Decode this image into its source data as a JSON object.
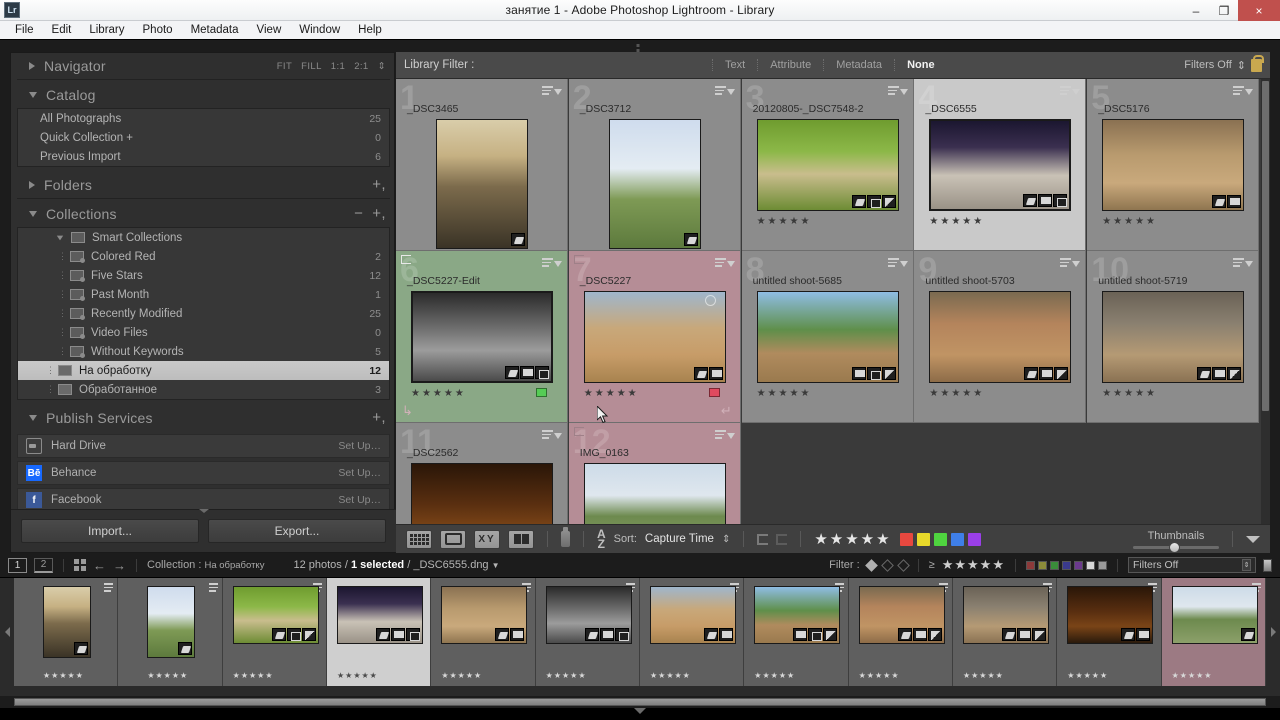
{
  "window": {
    "title": "занятие 1 - Adobe Photoshop Lightroom - Library",
    "app_badge": "Lr",
    "minimize": "–",
    "restore": "❐",
    "close": "×"
  },
  "menubar": {
    "items": [
      "File",
      "Edit",
      "Library",
      "Photo",
      "Metadata",
      "View",
      "Window",
      "Help"
    ]
  },
  "left_panel": {
    "navigator": {
      "title": "Navigator",
      "zoom_levels": [
        "FIT",
        "FILL",
        "1:1",
        "2:1"
      ]
    },
    "catalog": {
      "title": "Catalog",
      "items": [
        {
          "label": "All Photographs",
          "count": "25"
        },
        {
          "label": "Quick Collection  +",
          "count": "0"
        },
        {
          "label": "Previous Import",
          "count": "6"
        }
      ]
    },
    "folders": {
      "title": "Folders"
    },
    "collections": {
      "title": "Collections",
      "smart_label": "Smart Collections",
      "smart_items": [
        {
          "label": "Colored Red",
          "count": "2"
        },
        {
          "label": "Five Stars",
          "count": "12"
        },
        {
          "label": "Past Month",
          "count": "1"
        },
        {
          "label": "Recently Modified",
          "count": "25"
        },
        {
          "label": "Video Files",
          "count": "0"
        },
        {
          "label": "Without Keywords",
          "count": "5"
        }
      ],
      "items": [
        {
          "label": "На обработку",
          "count": "12",
          "selected": true
        },
        {
          "label": "Обработанное",
          "count": "3",
          "selected": false
        }
      ]
    },
    "publish_services": {
      "title": "Publish Services",
      "services": [
        {
          "label": "Hard Drive",
          "action": "Set Up…",
          "icon": "hard-drive-icon"
        },
        {
          "label": "Behance",
          "action": "Set Up…",
          "icon": "behance-icon",
          "mark": "Bē"
        },
        {
          "label": "Facebook",
          "action": "Set Up…",
          "icon": "facebook-icon",
          "mark": "f"
        }
      ]
    },
    "buttons": {
      "import": "Import...",
      "export": "Export..."
    }
  },
  "library_filter": {
    "label": "Library Filter :",
    "tabs": [
      "Text",
      "Attribute",
      "Metadata",
      "None"
    ],
    "active_tab": "None",
    "filters_state": "Filters Off",
    "lock_icon": "lock-icon"
  },
  "grid": {
    "cells": [
      {
        "index": "1",
        "title": "_DSC3465",
        "stars": "★★★★★",
        "badges": [
          "tag"
        ],
        "bg": "normal",
        "orient": "portrait"
      },
      {
        "index": "2",
        "title": "_DSC3712",
        "stars": "★★★★★",
        "badges": [
          "tag"
        ],
        "bg": "normal",
        "orient": "portrait"
      },
      {
        "index": "3",
        "title": "20120805-_DSC7548-2",
        "stars": "★★★★★",
        "badges": [
          "tag",
          "crop",
          "adj"
        ],
        "bg": "normal",
        "orient": "landscape"
      },
      {
        "index": "4",
        "title": "_DSC6555",
        "stars": "★★★★★",
        "badges": [
          "tag",
          "cnt",
          "crop"
        ],
        "bg": "selected",
        "orient": "landscape"
      },
      {
        "index": "5",
        "title": "_DSC5176",
        "stars": "★★★★★",
        "badges": [
          "tag",
          "cnt"
        ],
        "bg": "normal",
        "orient": "landscape"
      },
      {
        "index": "6",
        "title": "_DSC5227-Edit",
        "stars": "★★★★★",
        "badges": [
          "tag",
          "cnt",
          "crop"
        ],
        "bg": "green",
        "label_color": "#55cc55",
        "orient": "landscape"
      },
      {
        "index": "7",
        "title": "_DSC5227",
        "stars": "★★★★★",
        "badges": [
          "tag",
          "cnt"
        ],
        "bg": "pink",
        "label_color": "#e04a5f",
        "orient": "landscape"
      },
      {
        "index": "8",
        "title": "untitled shoot-5685",
        "stars": "★★★★★",
        "badges": [
          "cnt",
          "crop",
          "adj"
        ],
        "bg": "normal",
        "orient": "landscape"
      },
      {
        "index": "9",
        "title": "untitled shoot-5703",
        "stars": "★★★★★",
        "badges": [
          "tag",
          "cnt",
          "adj"
        ],
        "bg": "normal",
        "orient": "landscape"
      },
      {
        "index": "10",
        "title": "untitled shoot-5719",
        "stars": "★★★★★",
        "badges": [
          "tag",
          "cnt",
          "adj"
        ],
        "bg": "normal",
        "orient": "landscape"
      },
      {
        "index": "11",
        "title": "_DSC2562",
        "stars": "★★★★★",
        "badges": [
          "tag",
          "cnt"
        ],
        "bg": "normal",
        "orient": "landscape"
      },
      {
        "index": "12",
        "title": "IMG_0163",
        "stars": "★★★★★",
        "badges": [
          "tag"
        ],
        "bg": "pink",
        "orient": "landscape"
      }
    ]
  },
  "toolbar": {
    "view_modes": [
      "grid-view-icon",
      "loupe-view-icon",
      "compare-view-icon",
      "survey-view-icon"
    ],
    "painter": "spray-can-icon",
    "sort_glyph": "A\nZ",
    "sort_label": "Sort:",
    "sort_value": "Capture Time",
    "flags": [
      "flag-pick-icon",
      "flag-reject-icon"
    ],
    "stars": "★★★★★",
    "color_swatches": [
      "#e8483f",
      "#e8d92a",
      "#4fd43f",
      "#3f7fe8",
      "#9a3fe8"
    ],
    "thumbnails_label": "Thumbnails",
    "expand": "chevron-down-icon"
  },
  "filmstrip": {
    "page_numbers": [
      "1",
      "2"
    ],
    "grid_icon": "grid-icon",
    "back_icon": "back-arrow-icon",
    "forward_icon": "forward-arrow-icon",
    "source_label": "Collection :",
    "source_value": "На обработку",
    "count_text_prefix": "12 photos /",
    "count_selected": "1 selected",
    "count_file": "/ _DSC6555.dng",
    "filter_label": "Filter :",
    "filter_stars": "★★★★★",
    "filter_gte": "≥",
    "filter_swatches": [
      "#8c3a3a",
      "#8c8c3a",
      "#3a8c3a",
      "#3a3a8c",
      "#6b3a8c",
      "#d8d8d8",
      "#9a9a9a"
    ],
    "filters_off": "Filters Off",
    "thumbs": [
      {
        "title": "_DSC3465",
        "stars": "★★★★★",
        "bg": "normal",
        "orient": "portrait",
        "badges": [
          "tag"
        ]
      },
      {
        "title": "_DSC3712",
        "stars": "★★★★★",
        "bg": "normal",
        "orient": "portrait",
        "badges": [
          "tag"
        ]
      },
      {
        "title": "20120805-_DSC7548-2",
        "stars": "★★★★★",
        "bg": "normal",
        "orient": "landscape",
        "badges": [
          "tag",
          "crop",
          "adj"
        ]
      },
      {
        "title": "_DSC6555",
        "stars": "★★★★★",
        "bg": "selected",
        "orient": "landscape",
        "badges": [
          "tag",
          "cnt",
          "crop"
        ]
      },
      {
        "title": "_DSC5176",
        "stars": "★★★★★",
        "bg": "normal",
        "orient": "landscape",
        "badges": [
          "tag",
          "cnt"
        ]
      },
      {
        "title": "_DSC5227-Edit",
        "stars": "★★★★★",
        "bg": "normal",
        "orient": "landscape",
        "badges": [
          "tag",
          "cnt",
          "crop"
        ]
      },
      {
        "title": "_DSC5227",
        "stars": "★★★★★",
        "bg": "normal",
        "orient": "landscape",
        "badges": [
          "tag",
          "cnt"
        ]
      },
      {
        "title": "untitled shoot-5685",
        "stars": "★★★★★",
        "bg": "normal",
        "orient": "landscape",
        "badges": [
          "cnt",
          "crop",
          "adj"
        ]
      },
      {
        "title": "untitled shoot-5703",
        "stars": "★★★★★",
        "bg": "normal",
        "orient": "landscape",
        "badges": [
          "tag",
          "cnt",
          "adj"
        ]
      },
      {
        "title": "untitled shoot-5719",
        "stars": "★★★★★",
        "bg": "normal",
        "orient": "landscape",
        "badges": [
          "tag",
          "cnt",
          "adj"
        ]
      },
      {
        "title": "_DSC2562",
        "stars": "★★★★★",
        "bg": "normal",
        "orient": "landscape",
        "badges": [
          "tag",
          "cnt"
        ]
      },
      {
        "title": "IMG_0163",
        "stars": "★★★★★",
        "bg": "pink",
        "orient": "landscape",
        "badges": [
          "tag"
        ]
      }
    ]
  }
}
